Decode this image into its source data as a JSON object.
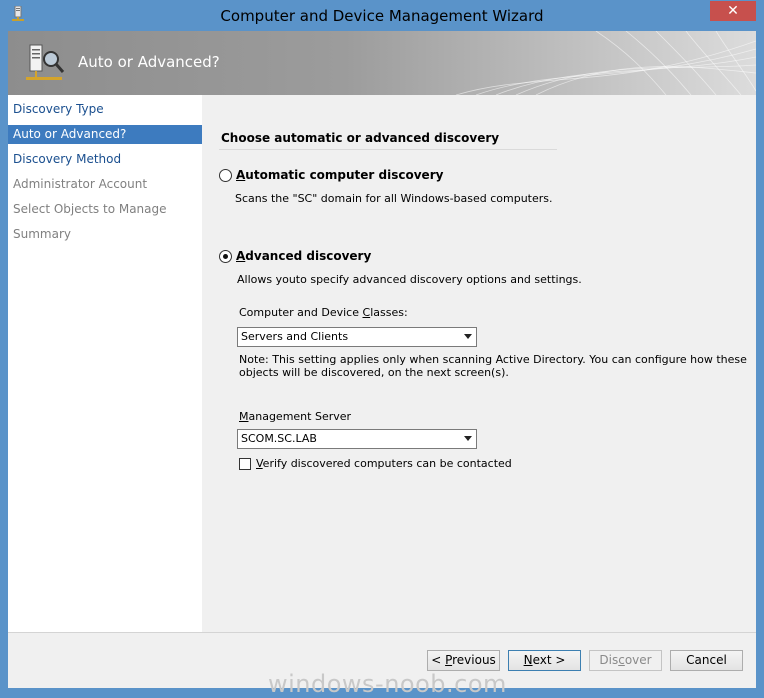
{
  "window": {
    "title": "Computer and Device Management Wizard",
    "close_label": "✕"
  },
  "header": {
    "title": "Auto or Advanced?"
  },
  "sidebar": {
    "items": [
      {
        "label": "Discovery Type"
      },
      {
        "label": "Auto or Advanced?"
      },
      {
        "label": "Discovery Method"
      },
      {
        "label": "Administrator Account"
      },
      {
        "label": "Select Objects to Manage"
      },
      {
        "label": "Summary"
      }
    ]
  },
  "main": {
    "section_title": "Choose automatic or advanced discovery",
    "automatic": {
      "label_first": "A",
      "label_rest": "utomatic computer discovery",
      "description": "Scans the \"SC\" domain for all Windows-based computers.",
      "checked": false
    },
    "advanced": {
      "label_first": "A",
      "label_rest": "dvanced discovery",
      "description": "Allows youto specify advanced discovery options and settings.",
      "checked": true
    },
    "classes": {
      "label_pre": "Computer and Device ",
      "label_ul": "C",
      "label_post": "lasses:",
      "value": "Servers and Clients"
    },
    "note_line1": "Note: This setting applies only when scanning Active Directory.  You can configure how these",
    "note_line2": "objects will be discovered, on the next screen(s).",
    "server": {
      "label_ul": "M",
      "label_post": "anagement Server",
      "value": "SCOM.SC.LAB"
    },
    "verify": {
      "label_ul": "V",
      "label_post": "erify discovered computers can be contacted",
      "checked": false
    }
  },
  "buttons": {
    "previous_pre": "< ",
    "previous_ul": "P",
    "previous_post": "revious",
    "next_ul": "N",
    "next_post": "ext >",
    "discover_pre": "Dis",
    "discover_ul": "c",
    "discover_post": "over",
    "cancel": "Cancel"
  },
  "watermark": "windows-noob.com"
}
